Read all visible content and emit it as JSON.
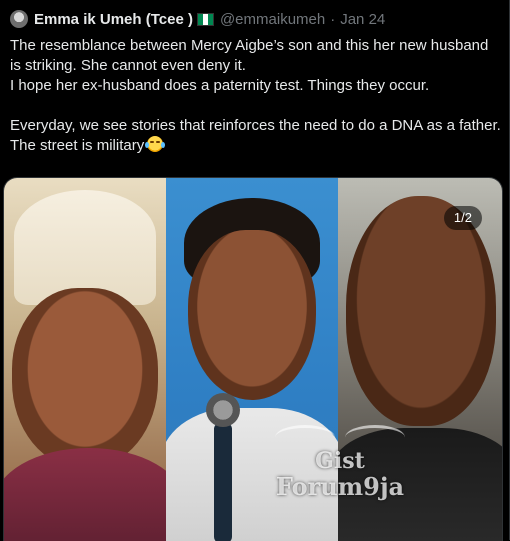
{
  "tweet": {
    "author_name": "Emma ik Umeh (Tcee )",
    "handle": "@emmaikumeh",
    "separator": "·",
    "date": "Jan 24",
    "flag_colors": [
      "#008751",
      "#ffffff",
      "#008751"
    ],
    "text_para1_line1": "The resemblance between Mercy Aigbe’s son and this her new husband is striking. She cannot even deny it.",
    "text_para1_line2": "I hope her ex-husband does a paternity test. Things they occur.",
    "text_para2": "Everyday, we see stories that reinforces the need to do a DNA as a father. The street is military",
    "emoji": "face-with-tears-of-joy-icon"
  },
  "media": {
    "counter": "1/2",
    "watermark_line1": "Gist",
    "watermark_line2": "Forum9ja"
  },
  "colors": {
    "background": "#000000",
    "text_primary": "#e7e9ea",
    "text_secondary": "#71767b",
    "border": "#2f3336"
  }
}
